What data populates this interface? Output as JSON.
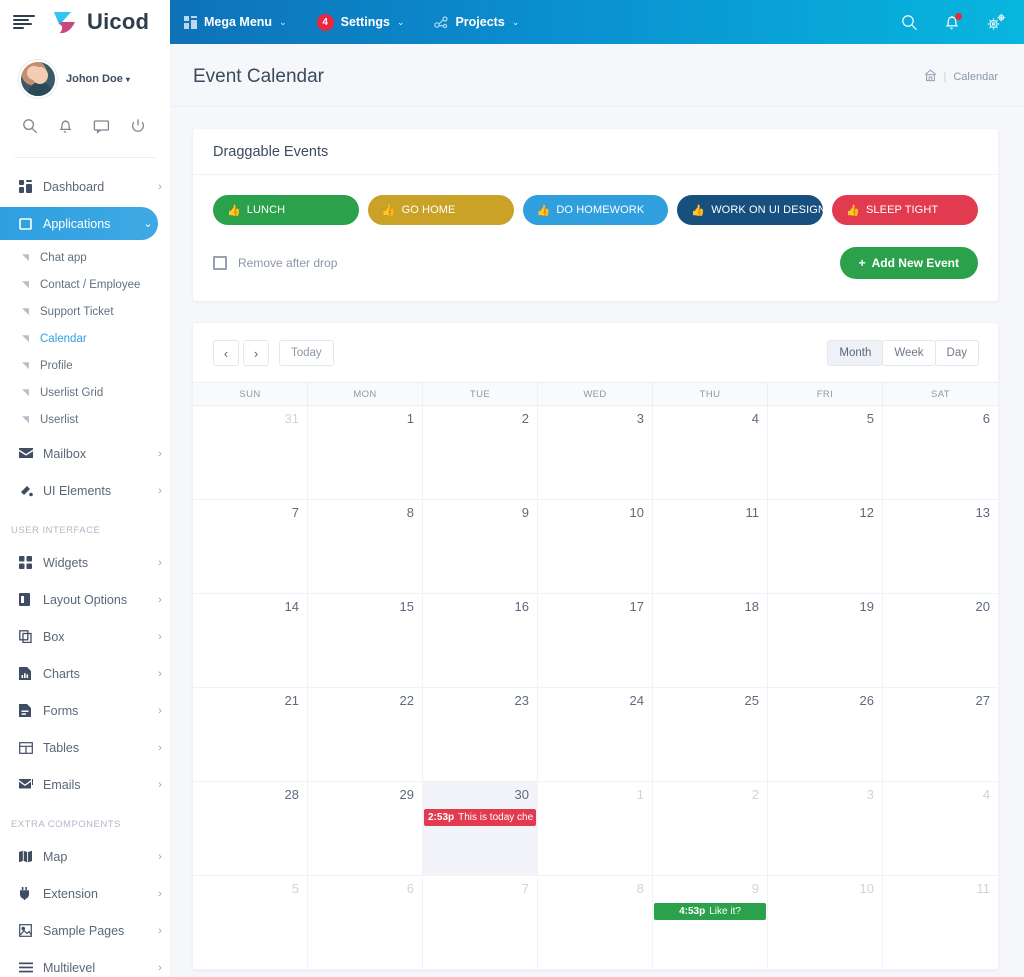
{
  "header": {
    "brand": "Uicod",
    "menu_icon": "hamburger-icon",
    "megamenu": [
      {
        "label": "Mega Menu",
        "icon": "grid-icon",
        "caret": "⌄",
        "badge": null
      },
      {
        "label": "Settings",
        "icon": null,
        "caret": "⌄",
        "badge": "4"
      },
      {
        "label": "Projects",
        "icon": "share-nodes-icon",
        "caret": "⌄",
        "badge": null
      }
    ],
    "icons": [
      "search-icon",
      "bell-icon",
      "gears-icon"
    ],
    "notification_dot": true
  },
  "sidebar": {
    "profile": {
      "name": "Johon Doe",
      "caret": "▾"
    },
    "quick_icons": [
      "search-icon",
      "bell-icon",
      "chat-icon",
      "power-icon"
    ],
    "menu": [
      {
        "label": "Dashboard",
        "icon": "dashboard-icon",
        "arrow": "›",
        "active": false
      },
      {
        "label": "Applications",
        "icon": "window-icon",
        "arrow": "⌄",
        "active": true
      }
    ],
    "submenu": [
      {
        "label": "Chat app",
        "current": false
      },
      {
        "label": "Contact / Employee",
        "current": false
      },
      {
        "label": "Support Ticket",
        "current": false
      },
      {
        "label": "Calendar",
        "current": true
      },
      {
        "label": "Profile",
        "current": false
      },
      {
        "label": "Userlist Grid",
        "current": false
      },
      {
        "label": "Userlist",
        "current": false
      }
    ],
    "menu2": [
      {
        "label": "Mailbox",
        "icon": "envelope-icon",
        "arrow": "›"
      },
      {
        "label": "UI Elements",
        "icon": "paint-icon",
        "arrow": "›"
      }
    ],
    "section_ui": "USER INTERFACE",
    "menu3": [
      {
        "label": "Widgets",
        "icon": "widgets-icon",
        "arrow": "›"
      },
      {
        "label": "Layout Options",
        "icon": "layout-icon",
        "arrow": "›"
      },
      {
        "label": "Box",
        "icon": "box-icon",
        "arrow": "›"
      },
      {
        "label": "Charts",
        "icon": "chart-icon",
        "arrow": "›"
      },
      {
        "label": "Forms",
        "icon": "form-icon",
        "arrow": "›"
      },
      {
        "label": "Tables",
        "icon": "table-icon",
        "arrow": "›"
      },
      {
        "label": "Emails",
        "icon": "email-icon",
        "arrow": "›"
      }
    ],
    "section_extra": "EXTRA COMPONENTS",
    "menu4": [
      {
        "label": "Map",
        "icon": "map-icon",
        "arrow": "›"
      },
      {
        "label": "Extension",
        "icon": "plug-icon",
        "arrow": "›"
      },
      {
        "label": "Sample Pages",
        "icon": "page-icon",
        "arrow": "›"
      },
      {
        "label": "Multilevel",
        "icon": "list-icon",
        "arrow": "›"
      }
    ]
  },
  "page": {
    "title": "Event Calendar",
    "breadcrumb": {
      "home_icon": "home-icon",
      "separator": "|",
      "current": "Calendar"
    }
  },
  "draggable": {
    "panel_title": "Draggable Events",
    "events": [
      {
        "label": "LUNCH",
        "color": "#2ca14c",
        "icon": "thumbs-up-icon"
      },
      {
        "label": "GO HOME",
        "color": "#c9a227",
        "icon": "thumbs-up-icon"
      },
      {
        "label": "DO HOMEWORK",
        "color": "#2f9fdd",
        "icon": "thumbs-up-icon"
      },
      {
        "label": "WORK ON UI DESIGN",
        "color": "#17507f",
        "icon": "thumbs-up-icon"
      },
      {
        "label": "SLEEP TIGHT",
        "color": "#e23a4e",
        "icon": "thumbs-up-icon"
      }
    ],
    "remove_after_drop": {
      "label": "Remove after drop",
      "checked": false
    },
    "add_button": {
      "label": "Add New Event",
      "plus": "+",
      "color": "#2ca14c"
    }
  },
  "calendar": {
    "prev": "‹",
    "next": "›",
    "today_label": "Today",
    "views": [
      {
        "label": "Month",
        "active": true
      },
      {
        "label": "Week",
        "active": false
      },
      {
        "label": "Day",
        "active": false
      }
    ],
    "day_names": [
      "SUN",
      "MON",
      "TUE",
      "WED",
      "THU",
      "FRI",
      "SAT"
    ],
    "weeks": [
      [
        {
          "day": "31",
          "other": true
        },
        {
          "day": "1"
        },
        {
          "day": "2"
        },
        {
          "day": "3"
        },
        {
          "day": "4"
        },
        {
          "day": "5"
        },
        {
          "day": "6"
        }
      ],
      [
        {
          "day": "7"
        },
        {
          "day": "8"
        },
        {
          "day": "9"
        },
        {
          "day": "10"
        },
        {
          "day": "11"
        },
        {
          "day": "12"
        },
        {
          "day": "13"
        }
      ],
      [
        {
          "day": "14"
        },
        {
          "day": "15"
        },
        {
          "day": "16"
        },
        {
          "day": "17"
        },
        {
          "day": "18"
        },
        {
          "day": "19"
        },
        {
          "day": "20"
        }
      ],
      [
        {
          "day": "21"
        },
        {
          "day": "22"
        },
        {
          "day": "23"
        },
        {
          "day": "24"
        },
        {
          "day": "25"
        },
        {
          "day": "26"
        },
        {
          "day": "27"
        }
      ],
      [
        {
          "day": "28"
        },
        {
          "day": "29"
        },
        {
          "day": "30",
          "today": true,
          "event": {
            "time": "2:53p",
            "title": "This is today che",
            "color": "#e23a4e",
            "centered": false
          }
        },
        {
          "day": "1",
          "other": true
        },
        {
          "day": "2",
          "other": true
        },
        {
          "day": "3",
          "other": true
        },
        {
          "day": "4",
          "other": true
        }
      ],
      [
        {
          "day": "5",
          "other": true
        },
        {
          "day": "6",
          "other": true
        },
        {
          "day": "7",
          "other": true
        },
        {
          "day": "8",
          "other": true
        },
        {
          "day": "9",
          "other": true,
          "event": {
            "time": "4:53p",
            "title": "Like it?",
            "color": "#2ca14c",
            "centered": true
          }
        },
        {
          "day": "10",
          "other": true
        },
        {
          "day": "11",
          "other": true
        }
      ]
    ]
  }
}
